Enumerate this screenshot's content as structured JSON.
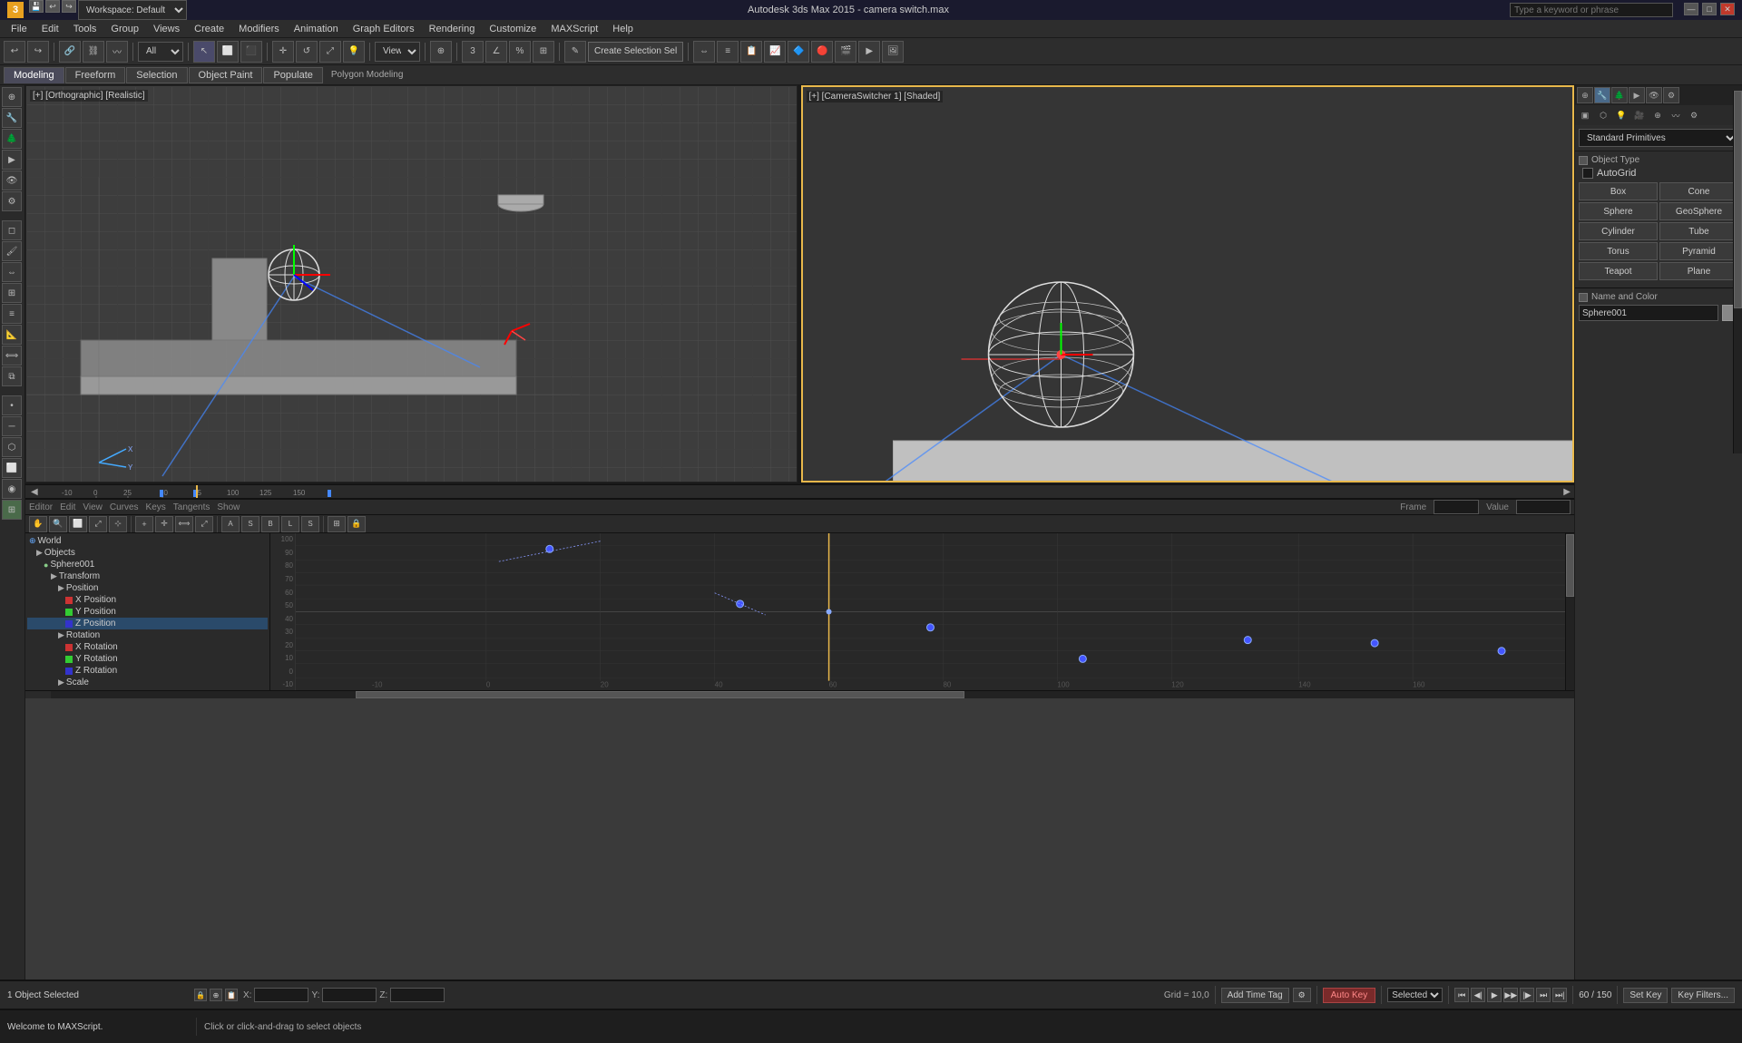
{
  "app": {
    "title": "Autodesk 3ds Max 2015 - camera switch.max",
    "workspace": "Workspace: Default"
  },
  "title_bar": {
    "logo": "3",
    "window_controls": [
      "—",
      "□",
      "✕"
    ]
  },
  "menu": {
    "items": [
      "File",
      "Edit",
      "Tools",
      "Group",
      "Views",
      "Create",
      "Modifiers",
      "Animation",
      "Graph Editors",
      "Rendering",
      "Customize",
      "MAXScript",
      "Help"
    ]
  },
  "toolbar": {
    "dropdown_filter": "All",
    "create_sel_label": "Create Selection Sel",
    "view_label": "View"
  },
  "secondary_toolbar": {
    "tabs": [
      "Modeling",
      "Freeform",
      "Selection",
      "Object Paint",
      "Populate"
    ],
    "active": "Modeling",
    "sub_label": "Polygon Modeling"
  },
  "viewports": {
    "ortho": {
      "label": "[+] [Orthographic] [Realistic]"
    },
    "camera": {
      "label": "[+] [CameraSwitcher 1] [Shaded]"
    }
  },
  "timeline": {
    "current_frame": "60",
    "total_frames": "150",
    "display": "60 / 150"
  },
  "graph_editor": {
    "toolbar_label": "Graph Editors",
    "frame_label": "Frame",
    "value_label": "Value",
    "menu_items": [
      "Editor",
      "Edit",
      "View",
      "Curves",
      "Keys",
      "Tangents",
      "Show"
    ],
    "y_values": [
      "100",
      "90",
      "80",
      "70",
      "60",
      "50",
      "40",
      "30",
      "20",
      "10",
      "0",
      "-10"
    ]
  },
  "scene_tree": {
    "world_label": "World",
    "items": [
      {
        "label": "Objects",
        "indent": 0,
        "icon": "▶"
      },
      {
        "label": "Sphere001",
        "indent": 1,
        "icon": "●",
        "selected": false
      },
      {
        "label": "Transform",
        "indent": 2,
        "icon": "▶"
      },
      {
        "label": "Position",
        "indent": 3,
        "icon": "▶"
      },
      {
        "label": "X Position",
        "indent": 4,
        "selected": false
      },
      {
        "label": "Y Position",
        "indent": 4,
        "selected": false
      },
      {
        "label": "Z Position",
        "indent": 4,
        "selected": true
      },
      {
        "label": "Rotation",
        "indent": 3,
        "icon": "▶"
      },
      {
        "label": "X Rotation",
        "indent": 4,
        "selected": false
      },
      {
        "label": "Y Rotation",
        "indent": 4,
        "selected": false
      },
      {
        "label": "Z Rotation",
        "indent": 4,
        "selected": false
      },
      {
        "label": "Scale",
        "indent": 3,
        "icon": "▶"
      }
    ]
  },
  "right_panel": {
    "dropdown_value": "Standard Primitives",
    "object_type_label": "Object Type",
    "autogrid_label": "AutoGrid",
    "buttons": [
      "Box",
      "Cone",
      "Sphere",
      "GeoSphere",
      "Cylinder",
      "Tube",
      "Torus",
      "Pyramid",
      "Teapot",
      "Plane"
    ],
    "name_color_label": "Name and Color",
    "name_value": "Sphere001"
  },
  "status_bar": {
    "object_count": "1 Object Selected",
    "hint": "Click or click-and-drag to select objects",
    "x_val": "",
    "y_val": "",
    "z_val": "",
    "grid_label": "Grid = 10,0",
    "auto_key_label": "Auto Key",
    "selected_label": "Selected",
    "set_key_label": "Set Key",
    "key_filters_label": "Key Filters...",
    "maxscript_msg": "Welcome to MAXScript."
  },
  "icons": {
    "undo": "↩",
    "redo": "↪",
    "select": "↖",
    "move": "✛",
    "rotate": "↺",
    "scale": "⤢",
    "play": "▶",
    "stop": "■",
    "prev_key": "⏮",
    "next_key": "⏭",
    "lock": "🔒",
    "world": "🌐"
  }
}
